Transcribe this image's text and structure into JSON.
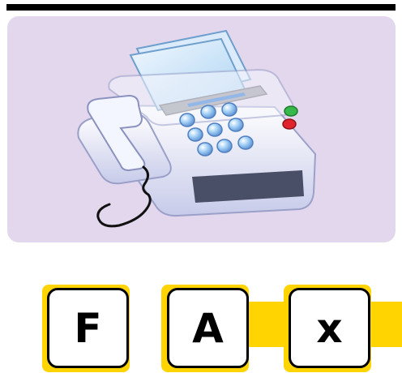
{
  "picture": {
    "subject": "fax-machine-icon",
    "background_color": "#e3d7ee"
  },
  "letter_tiles": [
    {
      "letter": "F"
    },
    {
      "letter": "A"
    },
    {
      "letter": "x"
    }
  ],
  "colors": {
    "tile_accent": "#ffd400",
    "tile_border": "#000000",
    "tile_face": "#ffffff"
  }
}
